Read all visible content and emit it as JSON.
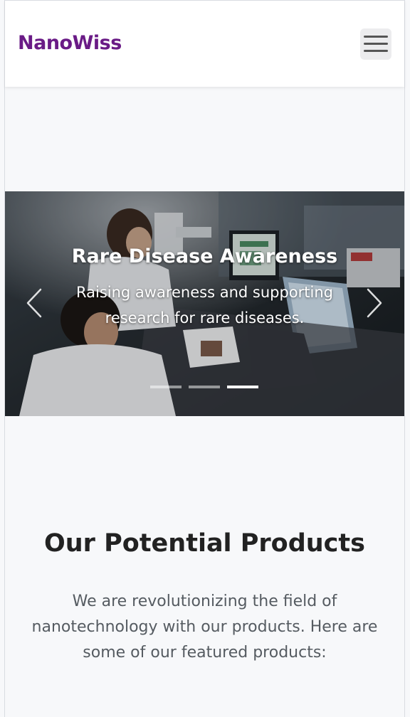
{
  "navbar": {
    "brand": "NanoWiss",
    "toggle_icon": "hamburger-menu-icon"
  },
  "carousel": {
    "slide_title": "Rare Disease Awareness",
    "slide_text": "Raising awareness and supporting research for rare diseases.",
    "prev_icon": "chevron-left-icon",
    "next_icon": "chevron-right-icon",
    "indicators": [
      false,
      false,
      true
    ]
  },
  "products": {
    "title": "Our Potential Products",
    "description": "We are revolutionizing the field of nanotechnology with our products. Here are some of our featured products:"
  },
  "colors": {
    "brand": "#6a1b86",
    "page_bg": "#f7f8fa"
  }
}
